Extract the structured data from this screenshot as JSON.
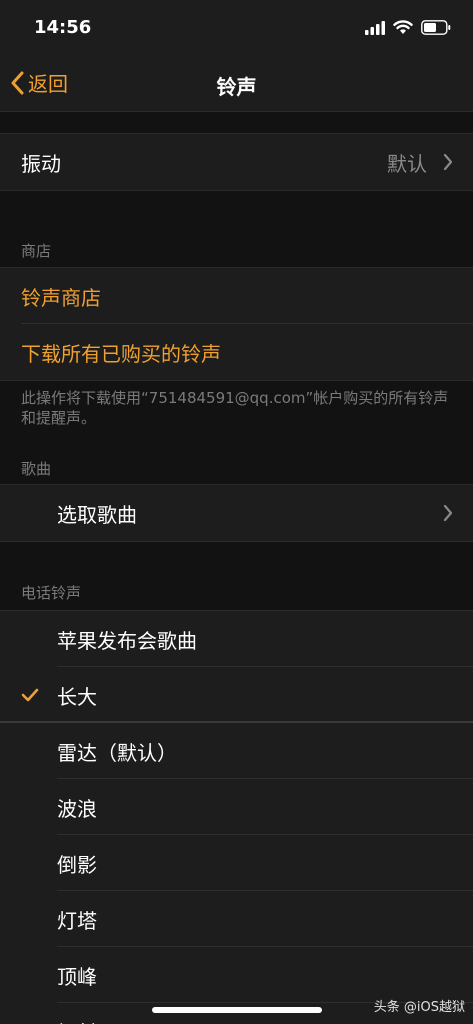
{
  "status_bar": {
    "time": "14:56"
  },
  "nav": {
    "back_label": "返回",
    "title": "铃声"
  },
  "vibration": {
    "label": "振动",
    "value": "默认"
  },
  "store_section": {
    "header": "商店",
    "store_link": "铃声商店",
    "download_all": "下载所有已购买的铃声",
    "footer": "此操作将下载使用“751484591@qq.com”帐户购买的所有铃声和提醒声。"
  },
  "songs_section": {
    "header": "歌曲",
    "pick_song": "选取歌曲"
  },
  "ringtones_section": {
    "header": "电话铃声",
    "items": [
      {
        "label": "苹果发布会歌曲",
        "checked": false
      },
      {
        "label": "长大",
        "checked": true
      },
      {
        "label": "雷达（默认）",
        "checked": false
      },
      {
        "label": "波浪",
        "checked": false
      },
      {
        "label": "倒影",
        "checked": false
      },
      {
        "label": "灯塔",
        "checked": false
      },
      {
        "label": "顶峰",
        "checked": false
      },
      {
        "label": "辐射",
        "checked": false
      }
    ]
  },
  "watermark": "头条 @iOS越狱",
  "colors": {
    "accent": "#f0a030",
    "background": "#121212",
    "cell": "#1d1d1d"
  }
}
